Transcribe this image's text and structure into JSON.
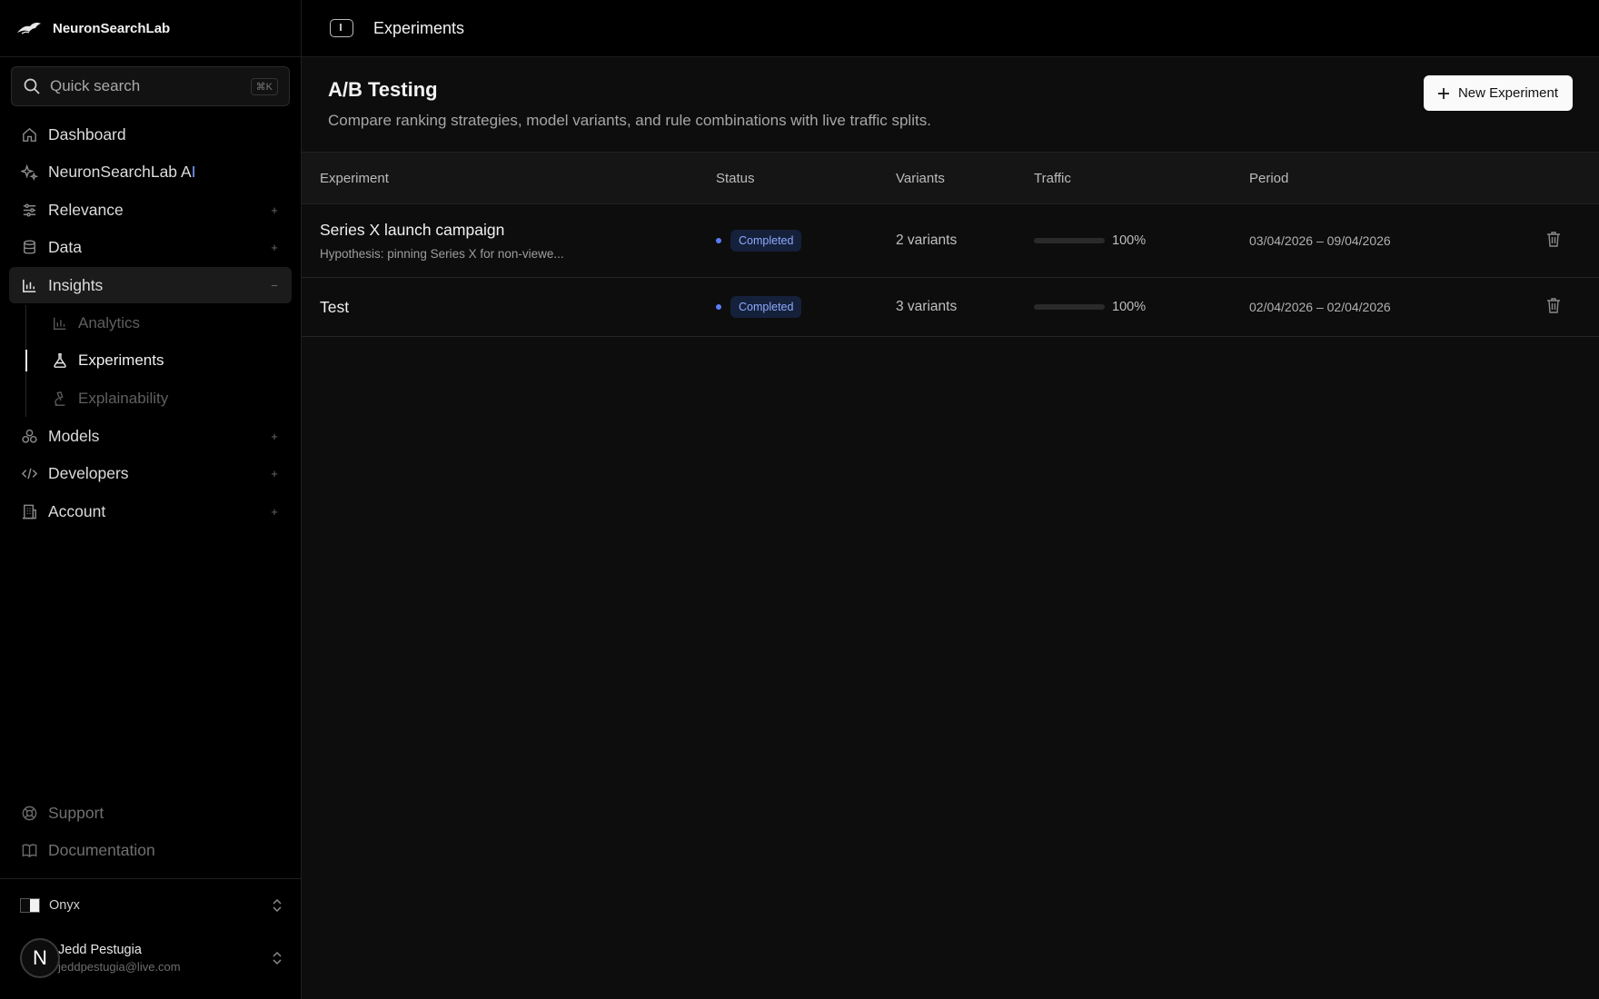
{
  "brand": {
    "name": "NeuronSearchLab"
  },
  "search": {
    "placeholder": "Quick search",
    "shortcut": "⌘K"
  },
  "nav": {
    "items": [
      {
        "label": "Dashboard",
        "icon": "home-icon",
        "toggle": ""
      },
      {
        "label_main": "NeuronSearchLab A",
        "label_accent": "I",
        "icon": "sparkles-icon",
        "toggle": ""
      },
      {
        "label": "Relevance",
        "icon": "sliders-icon",
        "toggle": "+"
      },
      {
        "label": "Data",
        "icon": "database-icon",
        "toggle": "+"
      },
      {
        "label": "Insights",
        "icon": "bar-chart-icon",
        "toggle": "−"
      },
      {
        "label": "Models",
        "icon": "models-icon",
        "toggle": "+"
      },
      {
        "label": "Developers",
        "icon": "code-icon",
        "toggle": "+"
      },
      {
        "label": "Account",
        "icon": "building-icon",
        "toggle": "+"
      }
    ],
    "insights_sub": [
      {
        "label": "Analytics",
        "icon": "analytics-icon"
      },
      {
        "label": "Experiments",
        "icon": "flask-icon"
      },
      {
        "label": "Explainability",
        "icon": "microscope-icon"
      }
    ],
    "footer": [
      {
        "label": "Support",
        "icon": "lifebuoy-icon"
      },
      {
        "label": "Documentation",
        "icon": "book-icon"
      }
    ]
  },
  "theme": {
    "label": "Onyx"
  },
  "user": {
    "initial": "N",
    "name": "Jedd Pestugia",
    "email": "jeddpestugia@live.com"
  },
  "topbar": {
    "title": "Experiments"
  },
  "page": {
    "title": "A/B Testing",
    "subtitle": "Compare ranking strategies, model variants, and rule combinations with live traffic splits.",
    "new_button": "New Experiment"
  },
  "table": {
    "headers": [
      "Experiment",
      "Status",
      "Variants",
      "Traffic",
      "Period"
    ],
    "rows": [
      {
        "name": "Series X launch campaign",
        "hypothesis": "Hypothesis: pinning Series X for non-viewe...",
        "status": "Completed",
        "variants": "2 variants",
        "traffic_pct": 100,
        "traffic_label": "100%",
        "period": "03/04/2026 – 09/04/2026"
      },
      {
        "name": "Test",
        "hypothesis": "",
        "status": "Completed",
        "variants": "3 variants",
        "traffic_pct": 100,
        "traffic_label": "100%",
        "period": "02/04/2026 – 02/04/2026"
      }
    ]
  },
  "colors": {
    "accent": "#6b6cf6",
    "status_dot": "#5b7cf7",
    "badge_text": "#8eaaff",
    "ai_accent": "#7b9cff"
  }
}
